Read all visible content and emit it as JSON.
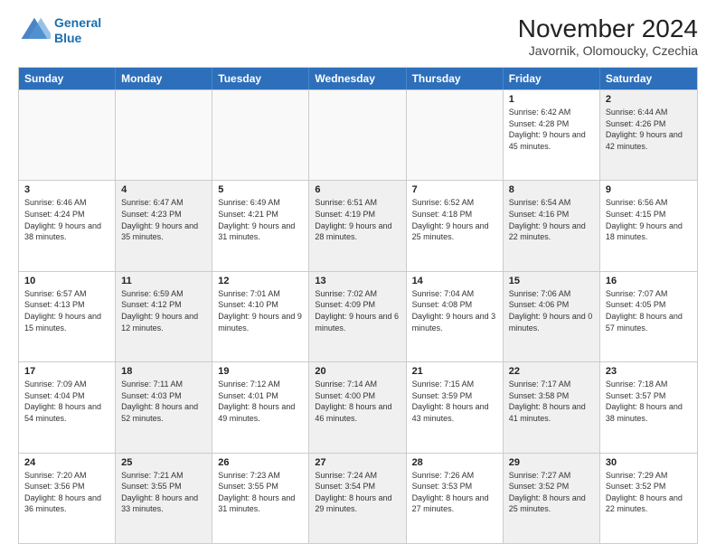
{
  "logo": {
    "line1": "General",
    "line2": "Blue"
  },
  "title": "November 2024",
  "location": "Javornik, Olomoucky, Czechia",
  "header_days": [
    "Sunday",
    "Monday",
    "Tuesday",
    "Wednesday",
    "Thursday",
    "Friday",
    "Saturday"
  ],
  "rows": [
    [
      {
        "day": "",
        "info": "",
        "shaded": false,
        "empty": true
      },
      {
        "day": "",
        "info": "",
        "shaded": false,
        "empty": true
      },
      {
        "day": "",
        "info": "",
        "shaded": false,
        "empty": true
      },
      {
        "day": "",
        "info": "",
        "shaded": false,
        "empty": true
      },
      {
        "day": "",
        "info": "",
        "shaded": false,
        "empty": true
      },
      {
        "day": "1",
        "info": "Sunrise: 6:42 AM\nSunset: 4:28 PM\nDaylight: 9 hours and 45 minutes.",
        "shaded": false,
        "empty": false
      },
      {
        "day": "2",
        "info": "Sunrise: 6:44 AM\nSunset: 4:26 PM\nDaylight: 9 hours and 42 minutes.",
        "shaded": true,
        "empty": false
      }
    ],
    [
      {
        "day": "3",
        "info": "Sunrise: 6:46 AM\nSunset: 4:24 PM\nDaylight: 9 hours and 38 minutes.",
        "shaded": false,
        "empty": false
      },
      {
        "day": "4",
        "info": "Sunrise: 6:47 AM\nSunset: 4:23 PM\nDaylight: 9 hours and 35 minutes.",
        "shaded": true,
        "empty": false
      },
      {
        "day": "5",
        "info": "Sunrise: 6:49 AM\nSunset: 4:21 PM\nDaylight: 9 hours and 31 minutes.",
        "shaded": false,
        "empty": false
      },
      {
        "day": "6",
        "info": "Sunrise: 6:51 AM\nSunset: 4:19 PM\nDaylight: 9 hours and 28 minutes.",
        "shaded": true,
        "empty": false
      },
      {
        "day": "7",
        "info": "Sunrise: 6:52 AM\nSunset: 4:18 PM\nDaylight: 9 hours and 25 minutes.",
        "shaded": false,
        "empty": false
      },
      {
        "day": "8",
        "info": "Sunrise: 6:54 AM\nSunset: 4:16 PM\nDaylight: 9 hours and 22 minutes.",
        "shaded": true,
        "empty": false
      },
      {
        "day": "9",
        "info": "Sunrise: 6:56 AM\nSunset: 4:15 PM\nDaylight: 9 hours and 18 minutes.",
        "shaded": false,
        "empty": false
      }
    ],
    [
      {
        "day": "10",
        "info": "Sunrise: 6:57 AM\nSunset: 4:13 PM\nDaylight: 9 hours and 15 minutes.",
        "shaded": false,
        "empty": false
      },
      {
        "day": "11",
        "info": "Sunrise: 6:59 AM\nSunset: 4:12 PM\nDaylight: 9 hours and 12 minutes.",
        "shaded": true,
        "empty": false
      },
      {
        "day": "12",
        "info": "Sunrise: 7:01 AM\nSunset: 4:10 PM\nDaylight: 9 hours and 9 minutes.",
        "shaded": false,
        "empty": false
      },
      {
        "day": "13",
        "info": "Sunrise: 7:02 AM\nSunset: 4:09 PM\nDaylight: 9 hours and 6 minutes.",
        "shaded": true,
        "empty": false
      },
      {
        "day": "14",
        "info": "Sunrise: 7:04 AM\nSunset: 4:08 PM\nDaylight: 9 hours and 3 minutes.",
        "shaded": false,
        "empty": false
      },
      {
        "day": "15",
        "info": "Sunrise: 7:06 AM\nSunset: 4:06 PM\nDaylight: 9 hours and 0 minutes.",
        "shaded": true,
        "empty": false
      },
      {
        "day": "16",
        "info": "Sunrise: 7:07 AM\nSunset: 4:05 PM\nDaylight: 8 hours and 57 minutes.",
        "shaded": false,
        "empty": false
      }
    ],
    [
      {
        "day": "17",
        "info": "Sunrise: 7:09 AM\nSunset: 4:04 PM\nDaylight: 8 hours and 54 minutes.",
        "shaded": false,
        "empty": false
      },
      {
        "day": "18",
        "info": "Sunrise: 7:11 AM\nSunset: 4:03 PM\nDaylight: 8 hours and 52 minutes.",
        "shaded": true,
        "empty": false
      },
      {
        "day": "19",
        "info": "Sunrise: 7:12 AM\nSunset: 4:01 PM\nDaylight: 8 hours and 49 minutes.",
        "shaded": false,
        "empty": false
      },
      {
        "day": "20",
        "info": "Sunrise: 7:14 AM\nSunset: 4:00 PM\nDaylight: 8 hours and 46 minutes.",
        "shaded": true,
        "empty": false
      },
      {
        "day": "21",
        "info": "Sunrise: 7:15 AM\nSunset: 3:59 PM\nDaylight: 8 hours and 43 minutes.",
        "shaded": false,
        "empty": false
      },
      {
        "day": "22",
        "info": "Sunrise: 7:17 AM\nSunset: 3:58 PM\nDaylight: 8 hours and 41 minutes.",
        "shaded": true,
        "empty": false
      },
      {
        "day": "23",
        "info": "Sunrise: 7:18 AM\nSunset: 3:57 PM\nDaylight: 8 hours and 38 minutes.",
        "shaded": false,
        "empty": false
      }
    ],
    [
      {
        "day": "24",
        "info": "Sunrise: 7:20 AM\nSunset: 3:56 PM\nDaylight: 8 hours and 36 minutes.",
        "shaded": false,
        "empty": false
      },
      {
        "day": "25",
        "info": "Sunrise: 7:21 AM\nSunset: 3:55 PM\nDaylight: 8 hours and 33 minutes.",
        "shaded": true,
        "empty": false
      },
      {
        "day": "26",
        "info": "Sunrise: 7:23 AM\nSunset: 3:55 PM\nDaylight: 8 hours and 31 minutes.",
        "shaded": false,
        "empty": false
      },
      {
        "day": "27",
        "info": "Sunrise: 7:24 AM\nSunset: 3:54 PM\nDaylight: 8 hours and 29 minutes.",
        "shaded": true,
        "empty": false
      },
      {
        "day": "28",
        "info": "Sunrise: 7:26 AM\nSunset: 3:53 PM\nDaylight: 8 hours and 27 minutes.",
        "shaded": false,
        "empty": false
      },
      {
        "day": "29",
        "info": "Sunrise: 7:27 AM\nSunset: 3:52 PM\nDaylight: 8 hours and 25 minutes.",
        "shaded": true,
        "empty": false
      },
      {
        "day": "30",
        "info": "Sunrise: 7:29 AM\nSunset: 3:52 PM\nDaylight: 8 hours and 22 minutes.",
        "shaded": false,
        "empty": false
      }
    ]
  ]
}
